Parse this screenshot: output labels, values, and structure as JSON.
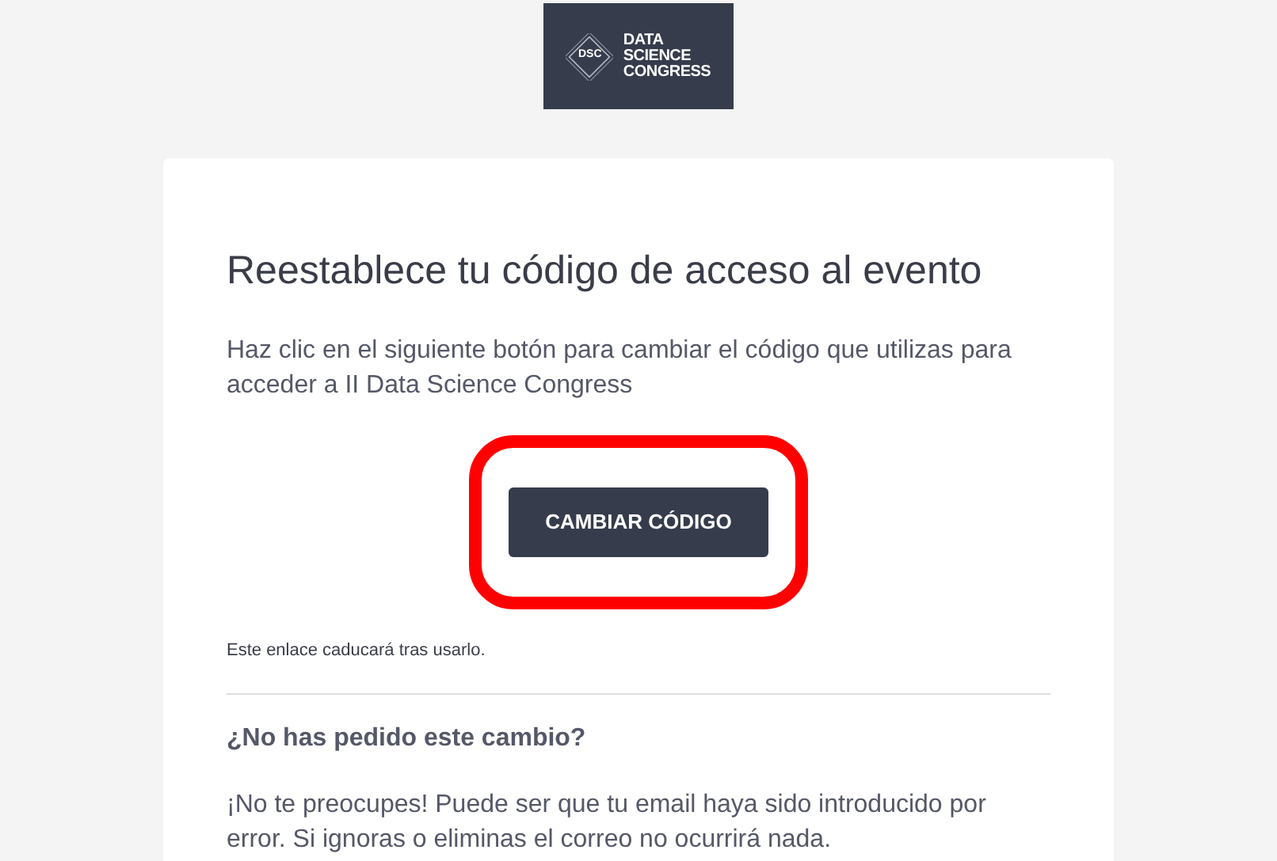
{
  "logo": {
    "badge": "DSC",
    "lines": [
      "DATA",
      "SCIENCE",
      "CONGRESS"
    ]
  },
  "email": {
    "title": "Reestablece tu código de acceso al evento",
    "intro": "Haz clic en el siguiente botón para cambiar el código que utilizas para acceder a II Data Science Congress",
    "button": {
      "label": "CAMBIAR CÓDIGO",
      "highlighted": true
    },
    "expiry_note": "Este enlace caducará tras usarlo.",
    "subheading": "¿No has pedido este cambio?",
    "body": "¡No te preocupes! Puede ser que tu email haya sido introducido por error. Si ignoras o eliminas el correo no ocurrirá nada."
  }
}
